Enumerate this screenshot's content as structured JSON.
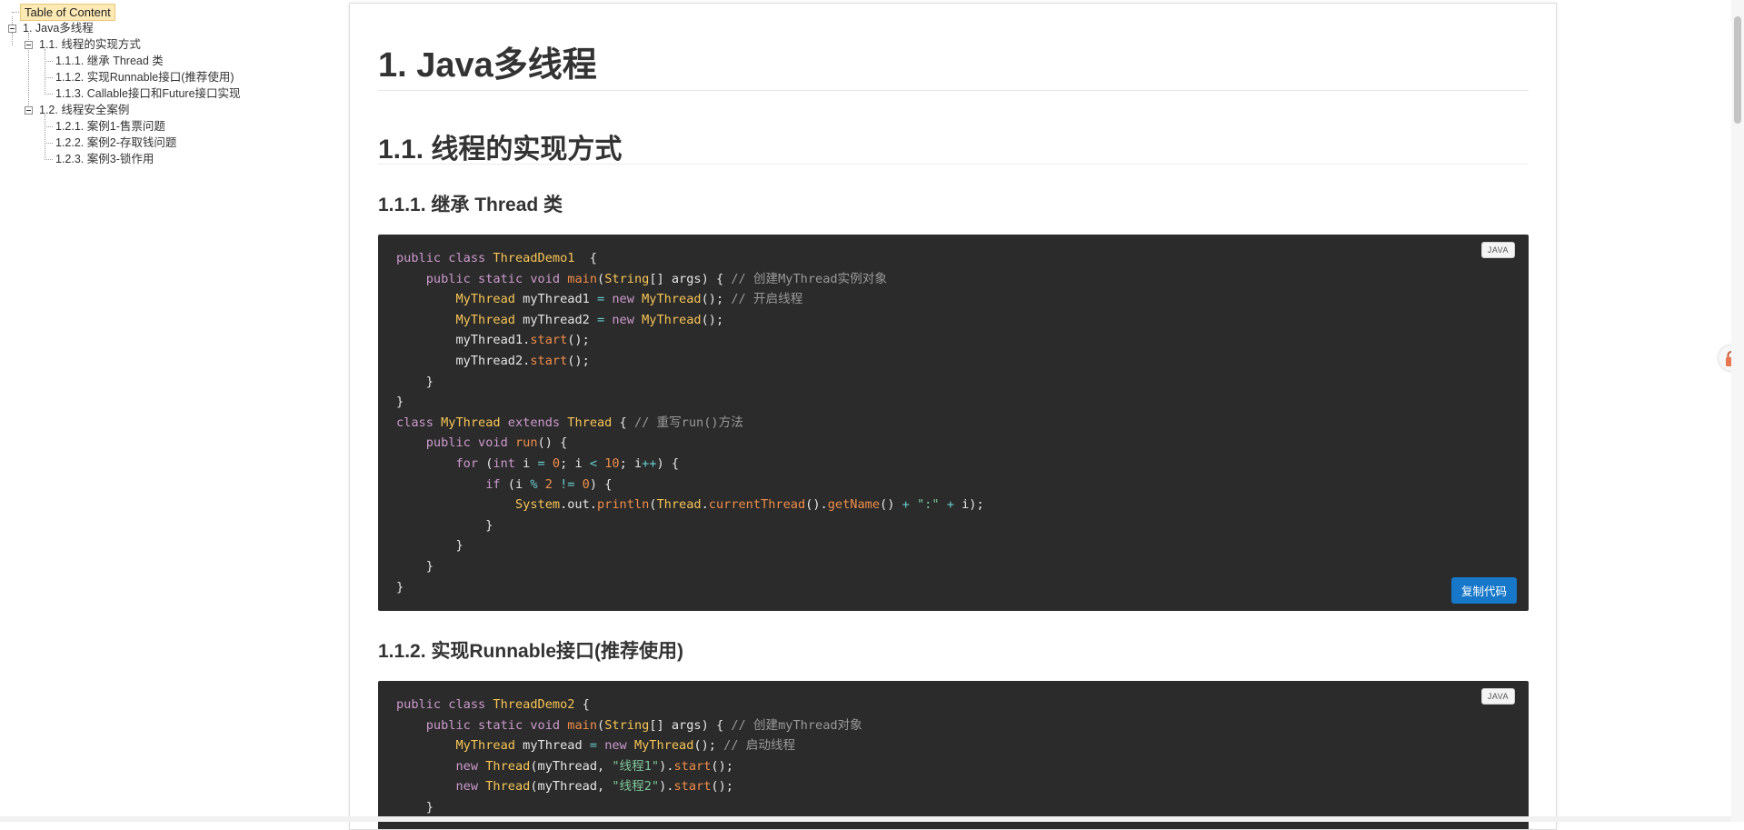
{
  "toc": {
    "title": "Table of Content",
    "items": [
      {
        "label": "1. Java多线程"
      },
      {
        "label": "1.1. 线程的实现方式"
      },
      {
        "label": "1.1.1. 继承 Thread 类"
      },
      {
        "label": "1.1.2. 实现Runnable接口(推荐使用)"
      },
      {
        "label": "1.1.3. Callable接口和Future接口实现"
      },
      {
        "label": "1.2. 线程安全案例"
      },
      {
        "label": "1.2.1. 案例1-售票问题"
      },
      {
        "label": "1.2.2. 案例2-存取钱问题"
      },
      {
        "label": "1.2.3. 案例3-锁作用"
      }
    ]
  },
  "article": {
    "h1": "1. Java多线程",
    "h2": "1.1. 线程的实现方式",
    "h3_1": "1.1.1. 继承 Thread 类",
    "h3_2": "1.1.2. 实现Runnable接口(推荐使用)",
    "code1_lang": "JAVA",
    "code1_copy": "复制代码",
    "code2_lang": "JAVA"
  },
  "code1_lines": [
    [
      [
        "kw",
        "public "
      ],
      [
        "kw",
        "class "
      ],
      [
        "cls",
        "ThreadDemo1"
      ],
      [
        "",
        "  {"
      ]
    ],
    [
      [
        "",
        "    "
      ],
      [
        "kw",
        "public "
      ],
      [
        "kw",
        "static "
      ],
      [
        "kw",
        "void "
      ],
      [
        "fn",
        "main"
      ],
      [
        "",
        "("
      ],
      [
        "cls",
        "String"
      ],
      [
        "",
        "[] args) { "
      ],
      [
        "cm",
        "// 创建MyThread实例对象"
      ]
    ],
    [
      [
        "",
        "        "
      ],
      [
        "cls",
        "MyThread"
      ],
      [
        "",
        " myThread1 "
      ],
      [
        "op",
        "= "
      ],
      [
        "kw",
        "new "
      ],
      [
        "cls",
        "MyThread"
      ],
      [
        "",
        "(); "
      ],
      [
        "cm",
        "// 开启线程"
      ]
    ],
    [
      [
        "",
        "        "
      ],
      [
        "cls",
        "MyThread"
      ],
      [
        "",
        " myThread2 "
      ],
      [
        "op",
        "= "
      ],
      [
        "kw",
        "new "
      ],
      [
        "cls",
        "MyThread"
      ],
      [
        "",
        "();"
      ]
    ],
    [
      [
        "",
        "        myThread1."
      ],
      [
        "fn",
        "start"
      ],
      [
        "",
        "();"
      ]
    ],
    [
      [
        "",
        "        myThread2."
      ],
      [
        "fn",
        "start"
      ],
      [
        "",
        "();"
      ]
    ],
    [
      [
        "",
        "    }"
      ]
    ],
    [
      [
        "",
        "}"
      ]
    ],
    [
      [
        "kw",
        "class "
      ],
      [
        "cls",
        "MyThread"
      ],
      [
        "",
        " "
      ],
      [
        "kw",
        "extends "
      ],
      [
        "cls",
        "Thread"
      ],
      [
        "",
        " { "
      ],
      [
        "cm",
        "// 重写run()方法"
      ]
    ],
    [
      [
        "",
        "    "
      ],
      [
        "kw",
        "public "
      ],
      [
        "kw",
        "void "
      ],
      [
        "fn",
        "run"
      ],
      [
        "",
        "() {"
      ]
    ],
    [
      [
        "",
        "        "
      ],
      [
        "kw",
        "for "
      ],
      [
        "",
        "("
      ],
      [
        "kw",
        "int "
      ],
      [
        "",
        "i "
      ],
      [
        "op",
        "= "
      ],
      [
        "num",
        "0"
      ],
      [
        "",
        "; i "
      ],
      [
        "op",
        "< "
      ],
      [
        "num",
        "10"
      ],
      [
        "",
        "; i"
      ],
      [
        "op",
        "++"
      ],
      [
        "",
        ") {"
      ]
    ],
    [
      [
        "",
        "            "
      ],
      [
        "kw",
        "if "
      ],
      [
        "",
        "(i "
      ],
      [
        "op",
        "% "
      ],
      [
        "num",
        "2 "
      ],
      [
        "op",
        "!= "
      ],
      [
        "num",
        "0"
      ],
      [
        "",
        ") {"
      ]
    ],
    [
      [
        "",
        "                "
      ],
      [
        "cls",
        "System"
      ],
      [
        "",
        ".out."
      ],
      [
        "fn",
        "println"
      ],
      [
        "",
        "("
      ],
      [
        "cls",
        "Thread"
      ],
      [
        "",
        "."
      ],
      [
        "fn",
        "currentThread"
      ],
      [
        "",
        "()."
      ],
      [
        "fn",
        "getName"
      ],
      [
        "",
        "() "
      ],
      [
        "op",
        "+ "
      ],
      [
        "str",
        "\":\" "
      ],
      [
        "op",
        "+ "
      ],
      [
        "",
        "i);"
      ]
    ],
    [
      [
        "",
        "            }"
      ]
    ],
    [
      [
        "",
        "        }"
      ]
    ],
    [
      [
        "",
        "    }"
      ]
    ],
    [
      [
        "",
        "}"
      ]
    ]
  ],
  "code2_lines": [
    [
      [
        "kw",
        "public "
      ],
      [
        "kw",
        "class "
      ],
      [
        "cls",
        "ThreadDemo2"
      ],
      [
        "",
        " {"
      ]
    ],
    [
      [
        "",
        "    "
      ],
      [
        "kw",
        "public "
      ],
      [
        "kw",
        "static "
      ],
      [
        "kw",
        "void "
      ],
      [
        "fn",
        "main"
      ],
      [
        "",
        "("
      ],
      [
        "cls",
        "String"
      ],
      [
        "",
        "[] args) { "
      ],
      [
        "cm",
        "// 创建myThread对象"
      ]
    ],
    [
      [
        "",
        "        "
      ],
      [
        "cls",
        "MyThread"
      ],
      [
        "",
        " myThread "
      ],
      [
        "op",
        "= "
      ],
      [
        "kw",
        "new "
      ],
      [
        "cls",
        "MyThread"
      ],
      [
        "",
        "(); "
      ],
      [
        "cm",
        "// 启动线程"
      ]
    ],
    [
      [
        "",
        "        "
      ],
      [
        "kw",
        "new "
      ],
      [
        "cls",
        "Thread"
      ],
      [
        "",
        "(myThread, "
      ],
      [
        "str",
        "\"线程1\""
      ],
      [
        "",
        ")."
      ],
      [
        "fn",
        "start"
      ],
      [
        "",
        "();"
      ]
    ],
    [
      [
        "",
        "        "
      ],
      [
        "kw",
        "new "
      ],
      [
        "cls",
        "Thread"
      ],
      [
        "",
        "(myThread, "
      ],
      [
        "str",
        "\"线程2\""
      ],
      [
        "",
        ")."
      ],
      [
        "fn",
        "start"
      ],
      [
        "",
        "();"
      ]
    ],
    [
      [
        "",
        "    }"
      ]
    ]
  ]
}
